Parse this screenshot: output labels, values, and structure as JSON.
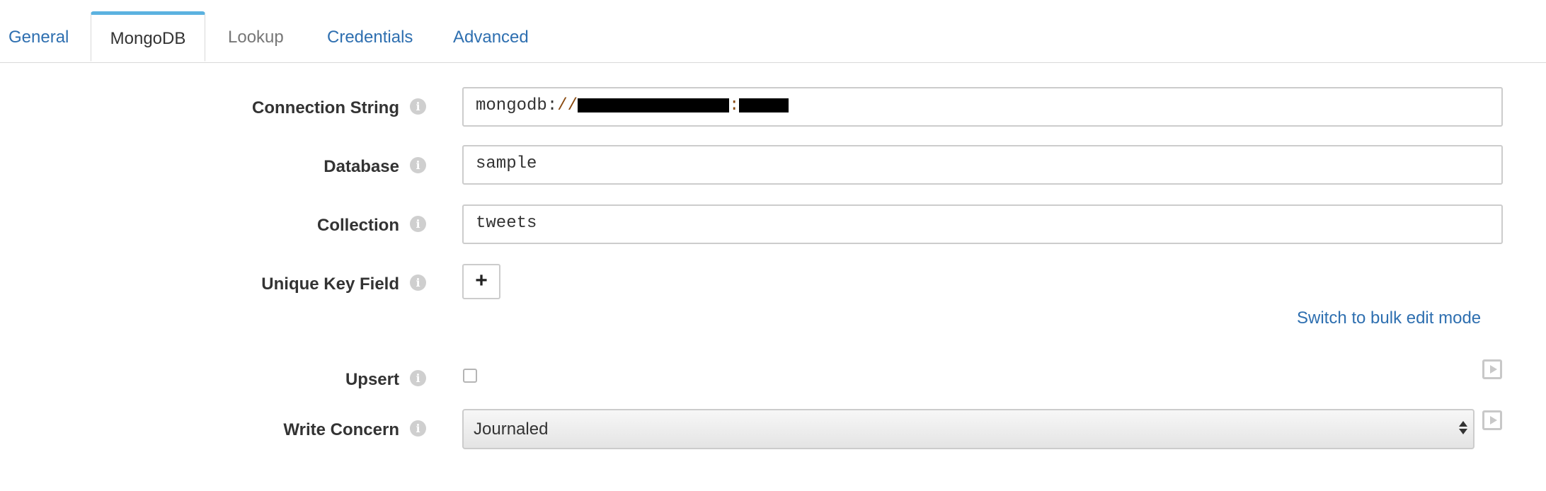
{
  "tabs": [
    {
      "label": "General"
    },
    {
      "label": "MongoDB"
    },
    {
      "label": "Lookup"
    },
    {
      "label": "Credentials"
    },
    {
      "label": "Advanced"
    }
  ],
  "form": {
    "connection_string": {
      "label": "Connection String",
      "scheme": "mongodb",
      "colon": ":",
      "slashes": "//",
      "sep": ":"
    },
    "database": {
      "label": "Database",
      "value": "sample"
    },
    "collection": {
      "label": "Collection",
      "value": "tweets"
    },
    "unique_key_field": {
      "label": "Unique Key Field",
      "add_label": "+"
    },
    "bulk_edit_link": "Switch to bulk edit mode",
    "upsert": {
      "label": "Upsert",
      "checked": false
    },
    "write_concern": {
      "label": "Write Concern",
      "selected": "Journaled"
    }
  },
  "icons": {
    "info": "info-icon",
    "play": "play-icon",
    "select_arrows": "sort-arrows-icon"
  },
  "colors": {
    "link": "#2e6fb0",
    "active_tab_accent": "#5bb2e0",
    "label": "#333333",
    "scheme_slashes": "#8a4a10"
  }
}
